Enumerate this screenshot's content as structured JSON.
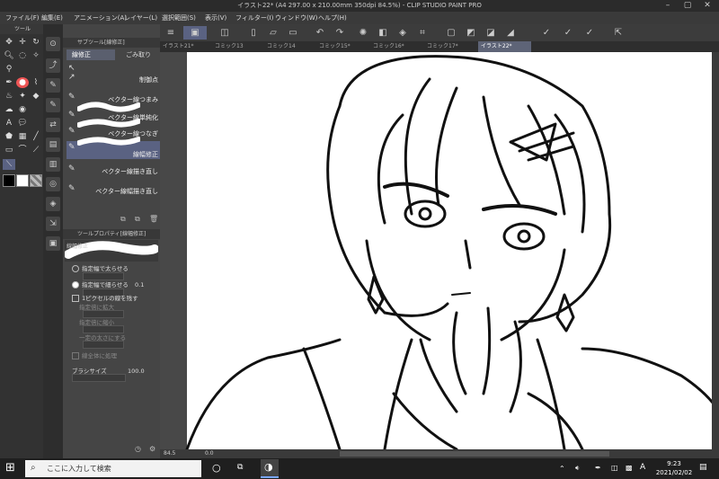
{
  "window": {
    "title": "イラスト22* (A4 297.00 x 210.00mm 350dpi 84.5%) - CLIP STUDIO PAINT PRO"
  },
  "menu": [
    "ファイル(F)",
    "編集(E)",
    "アニメーション(A)",
    "レイヤー(L)",
    "選択範囲(S)",
    "表示(V)",
    "フィルター(I)",
    "ウィンドウ(W)",
    "ヘルプ(H)"
  ],
  "tool_panel": {
    "header": "ツール"
  },
  "subtool_panel": {
    "header": "サブツール[線修正]",
    "tabs": [
      "線修正",
      "ごみ取り"
    ],
    "items": [
      {
        "label": "制御点",
        "selected": false
      },
      {
        "label": "ベクター線つまみ",
        "selected": false
      },
      {
        "label": "ベクター線単純化",
        "selected": false
      },
      {
        "label": "ベクター線つなぎ",
        "selected": false
      },
      {
        "label": "線幅修正",
        "selected": true
      },
      {
        "label": "ベクター線描き直し",
        "selected": false
      },
      {
        "label": "ベクター線幅描き直し",
        "selected": false
      }
    ]
  },
  "tool_property": {
    "header": "ツールプロパティ[線幅修正]",
    "preview_label": "線幅修正",
    "options": [
      {
        "label": "指定幅で太らせる",
        "type": "radio",
        "checked": false,
        "enabled": true
      },
      {
        "label": "指定幅で細らせる",
        "type": "radio",
        "checked": true,
        "enabled": true,
        "value": "0.1"
      },
      {
        "label": "1ピクセルの線を残す",
        "type": "checkbox",
        "checked": false,
        "enabled": true
      },
      {
        "label": "指定倍に拡大",
        "type": "radio",
        "checked": false,
        "enabled": false
      },
      {
        "label": "指定倍に縮小",
        "type": "radio",
        "checked": false,
        "enabled": false
      },
      {
        "label": "一定の太さにする",
        "type": "radio",
        "checked": false,
        "enabled": false
      },
      {
        "label": "線全体に処理",
        "type": "checkbox",
        "checked": false,
        "enabled": false
      }
    ],
    "brush_size": {
      "label": "ブラシサイズ",
      "value": "100.0"
    }
  },
  "tabs": [
    {
      "label": "イラスト21*",
      "active": false
    },
    {
      "label": "コミック13",
      "active": false
    },
    {
      "label": "コミック14",
      "active": false
    },
    {
      "label": "コミック15*",
      "active": false
    },
    {
      "label": "コミック16*",
      "active": false
    },
    {
      "label": "コミック17*",
      "active": false
    },
    {
      "label": "イラスト22*",
      "active": true
    }
  ],
  "status": {
    "zoom": "84.5",
    "angle": "0.0"
  },
  "taskbar": {
    "search_placeholder": "ここに入力して検索",
    "ime": "A",
    "time": "9:23",
    "date": "2021/02/02"
  },
  "colors": {
    "accent": "#5a6282",
    "canvas_bg": "#ffffff",
    "panel_bg": "#454545"
  }
}
